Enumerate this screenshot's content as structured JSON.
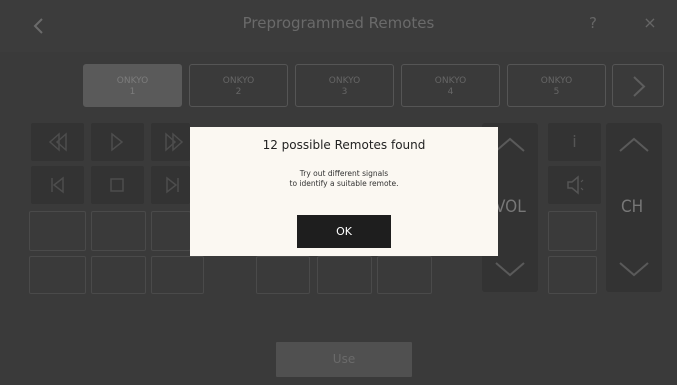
{
  "header": {
    "title": "Preprogrammed Remotes",
    "back_icon": "chevron-left-icon",
    "help_label": "?",
    "close_label": "×"
  },
  "tabs": [
    {
      "brand": "ONKYO",
      "number": "1",
      "active": true
    },
    {
      "brand": "ONKYO",
      "number": "2",
      "active": false
    },
    {
      "brand": "ONKYO",
      "number": "3",
      "active": false
    },
    {
      "brand": "ONKYO",
      "number": "4",
      "active": false
    },
    {
      "brand": "ONKYO",
      "number": "5",
      "active": false
    }
  ],
  "controls": {
    "vol_label": "VOL",
    "ch_label": "CH",
    "info_label": "i"
  },
  "footer": {
    "use_label": "Use"
  },
  "dialog": {
    "title": "12 possible Remotes found",
    "message_line1": "Try out different signals",
    "message_line2": "to identify a suitable remote.",
    "ok_label": "OK"
  },
  "colors": {
    "dialog_bg": "#fbf8f2",
    "ok_bg": "#1e1e1e"
  }
}
